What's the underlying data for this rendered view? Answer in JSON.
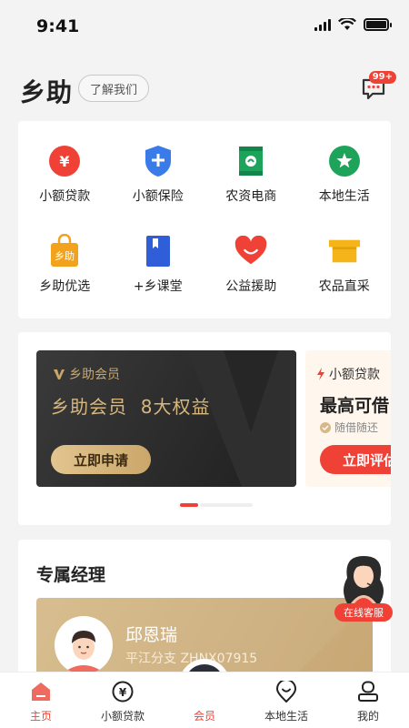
{
  "status_bar": {
    "time": "9:41"
  },
  "header": {
    "brand": "乡助",
    "about_label": "了解我们",
    "msg_badge": "99+"
  },
  "services": [
    {
      "label": "小额贷款",
      "icon": "yuan-coin-icon",
      "color": "#ef4136"
    },
    {
      "label": "小额保险",
      "icon": "shield-plus-icon",
      "color": "#3a7bea"
    },
    {
      "label": "农资电商",
      "icon": "seed-bag-icon",
      "color": "#1ea45a"
    },
    {
      "label": "本地生活",
      "icon": "star-location-icon",
      "color": "#1ea45a"
    },
    {
      "label": "乡助优选",
      "icon": "shopping-bag-icon",
      "color": "#f2a21b"
    },
    {
      "label": "+乡课堂",
      "icon": "book-icon",
      "color": "#2f5ed8"
    },
    {
      "label": "公益援助",
      "icon": "heart-smile-icon",
      "color": "#ef4136"
    },
    {
      "label": "农品直采",
      "icon": "shop-icon",
      "color": "#f4b41a"
    }
  ],
  "banner": {
    "member": {
      "tag": "乡助会员",
      "title": "乡助会员  8大权益",
      "button": "立即申请"
    },
    "loan": {
      "tag": "小额贷款",
      "title": "最高可借",
      "sub": "随借随还",
      "button": "立即评估"
    }
  },
  "manager": {
    "title": "专属经理",
    "name": "邱恩瑞",
    "branch": "平江分支 ZHNX07915",
    "online_service": "在线客服"
  },
  "tabbar": [
    {
      "label": "主页",
      "icon": "home-icon",
      "active": true
    },
    {
      "label": "小额贷款",
      "icon": "yuan-circle-icon"
    },
    {
      "label": "会员",
      "icon": "diamond-icon"
    },
    {
      "label": "本地生活",
      "icon": "location-smile-icon"
    },
    {
      "label": "我的",
      "icon": "user-icon"
    }
  ],
  "colors": {
    "accent": "#ef4136",
    "gold": "#d6b77e",
    "dark": "#2b2f3a"
  }
}
